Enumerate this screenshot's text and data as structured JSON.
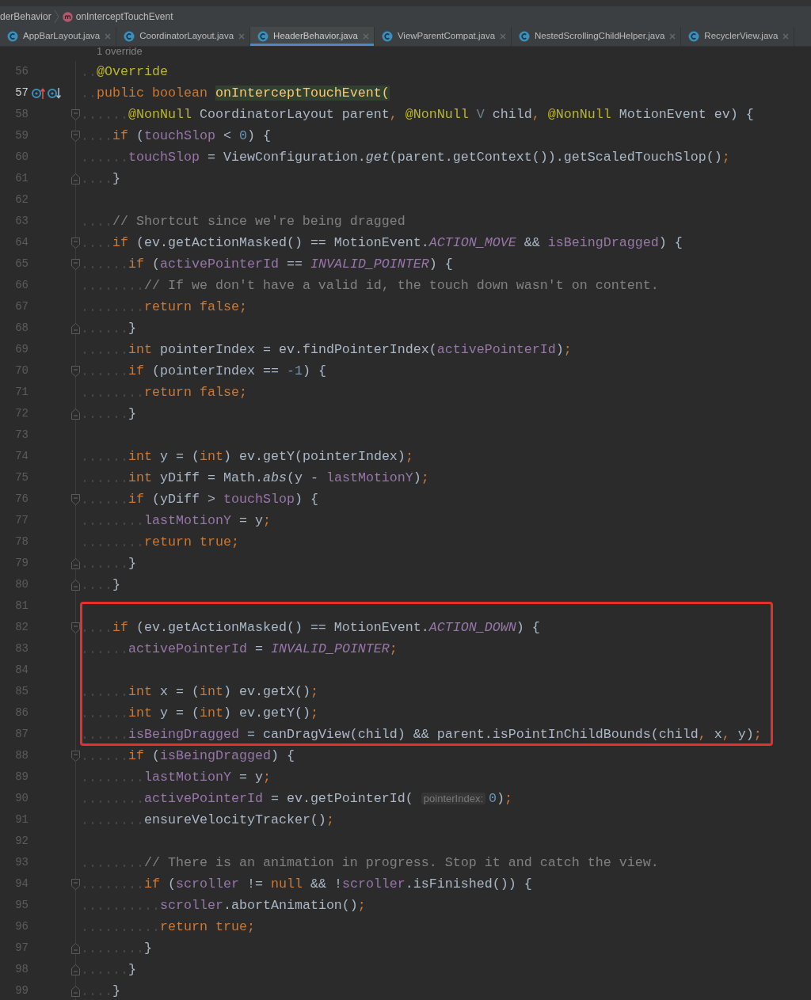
{
  "breadcrumb": [
    {
      "label": "derBehavior",
      "kind": "class"
    },
    {
      "label": "onInterceptTouchEvent",
      "kind": "method"
    }
  ],
  "tabs": [
    {
      "label": "AppBarLayout.java",
      "selected": false
    },
    {
      "label": "CoordinatorLayout.java",
      "selected": false
    },
    {
      "label": "HeaderBehavior.java",
      "selected": true
    },
    {
      "label": "ViewParentCompat.java",
      "selected": false
    },
    {
      "label": "NestedScrollingChildHelper.java",
      "selected": false
    },
    {
      "label": "RecyclerView.java",
      "selected": false
    }
  ],
  "code_vision": "1 override",
  "blocks": [
    {
      "boxed": false,
      "lines": [
        {
          "number": "56",
          "current": false,
          "tokens": [
            {
              "kind": "ann",
              "text": "  @Override"
            }
          ]
        },
        {
          "number": "57",
          "current": true,
          "gutter_icons": [
            {
              "kind": "overrides"
            },
            {
              "kind": "overridden"
            }
          ],
          "tokens": [
            {
              "kind": "kw",
              "text": "  public boolean "
            },
            {
              "kind": "decl",
              "text": "onInterceptTouchEvent("
            }
          ]
        },
        {
          "number": "58",
          "current": false,
          "fold": {
            "kind": "start"
          },
          "tokens": [
            {
              "kind": "ann",
              "text": "      @NonNull"
            },
            {
              "kind": "plain",
              "text": " CoordinatorLayout parent"
            },
            {
              "kind": "punct",
              "text": ","
            },
            {
              "kind": "ann",
              "text": " @NonNull"
            },
            {
              "kind": "tparam",
              "text": " V"
            },
            {
              "kind": "plain",
              "text": " child"
            },
            {
              "kind": "punct",
              "text": ","
            },
            {
              "kind": "ann",
              "text": " @NonNull"
            },
            {
              "kind": "plain",
              "text": " MotionEvent ev) {"
            }
          ]
        },
        {
          "number": "59",
          "current": false,
          "fold": {
            "kind": "start"
          },
          "tokens": [
            {
              "kind": "kw",
              "text": "    if"
            },
            {
              "kind": "plain",
              "text": " ("
            },
            {
              "kind": "field",
              "text": "touchSlop"
            },
            {
              "kind": "plain",
              "text": " < "
            },
            {
              "kind": "num",
              "text": "0"
            },
            {
              "kind": "plain",
              "text": ") {"
            }
          ]
        },
        {
          "number": "60",
          "current": false,
          "tokens": [
            {
              "kind": "field",
              "text": "      touchSlop"
            },
            {
              "kind": "plain",
              "text": " = ViewConfiguration."
            },
            {
              "kind": "static",
              "text": "get"
            },
            {
              "kind": "plain",
              "text": "(parent.getContext()).getScaledTouchSlop()"
            },
            {
              "kind": "punct",
              "text": ";"
            }
          ]
        },
        {
          "number": "61",
          "current": false,
          "fold": {
            "kind": "end"
          },
          "tokens": [
            {
              "kind": "plain",
              "text": "    }"
            }
          ]
        },
        {
          "number": "62",
          "current": false
        },
        {
          "number": "63",
          "current": false,
          "tokens": [
            {
              "kind": "comment",
              "text": "    // Shortcut since we're being dragged"
            }
          ]
        },
        {
          "number": "64",
          "current": false,
          "fold": {
            "kind": "start"
          },
          "tokens": [
            {
              "kind": "kw",
              "text": "    if"
            },
            {
              "kind": "plain",
              "text": " (ev.getActionMasked() == MotionEvent."
            },
            {
              "kind": "const",
              "text": "ACTION_MOVE"
            },
            {
              "kind": "plain",
              "text": " && "
            },
            {
              "kind": "field",
              "text": "isBeingDragged"
            },
            {
              "kind": "plain",
              "text": ") {"
            }
          ]
        },
        {
          "number": "65",
          "current": false,
          "fold": {
            "kind": "start"
          },
          "tokens": [
            {
              "kind": "kw",
              "text": "      if"
            },
            {
              "kind": "plain",
              "text": " ("
            },
            {
              "kind": "field",
              "text": "activePointerId"
            },
            {
              "kind": "plain",
              "text": " == "
            },
            {
              "kind": "const",
              "text": "INVALID_POINTER"
            },
            {
              "kind": "plain",
              "text": ") {"
            }
          ]
        },
        {
          "number": "66",
          "current": false,
          "tokens": [
            {
              "kind": "comment",
              "text": "        // If we don't have a valid id, the touch down wasn't on content."
            }
          ]
        },
        {
          "number": "67",
          "current": false,
          "tokens": [
            {
              "kind": "kw",
              "text": "        return false;"
            }
          ]
        },
        {
          "number": "68",
          "current": false,
          "fold": {
            "kind": "end"
          },
          "tokens": [
            {
              "kind": "plain",
              "text": "      }"
            }
          ]
        },
        {
          "number": "69",
          "current": false,
          "tokens": [
            {
              "kind": "kw",
              "text": "      int"
            },
            {
              "kind": "plain",
              "text": " pointerIndex = ev.findPointerIndex("
            },
            {
              "kind": "field",
              "text": "activePointerId"
            },
            {
              "kind": "plain",
              "text": ")"
            },
            {
              "kind": "punct",
              "text": ";"
            }
          ]
        },
        {
          "number": "70",
          "current": false,
          "fold": {
            "kind": "start"
          },
          "tokens": [
            {
              "kind": "kw",
              "text": "      if"
            },
            {
              "kind": "plain",
              "text": " (pointerIndex == "
            },
            {
              "kind": "num",
              "text": "-1"
            },
            {
              "kind": "plain",
              "text": ") {"
            }
          ]
        },
        {
          "number": "71",
          "current": false,
          "tokens": [
            {
              "kind": "kw",
              "text": "        return false;"
            }
          ]
        },
        {
          "number": "72",
          "current": false,
          "fold": {
            "kind": "end"
          },
          "tokens": [
            {
              "kind": "plain",
              "text": "      }"
            }
          ]
        },
        {
          "number": "73",
          "current": false
        },
        {
          "number": "74",
          "current": false,
          "tokens": [
            {
              "kind": "kw",
              "text": "      int"
            },
            {
              "kind": "plain",
              "text": " y = ("
            },
            {
              "kind": "kw",
              "text": "int"
            },
            {
              "kind": "plain",
              "text": ") ev.getY(pointerIndex)"
            },
            {
              "kind": "punct",
              "text": ";"
            }
          ]
        },
        {
          "number": "75",
          "current": false,
          "tokens": [
            {
              "kind": "kw",
              "text": "      int"
            },
            {
              "kind": "plain",
              "text": " yDiff = Math."
            },
            {
              "kind": "static",
              "text": "abs"
            },
            {
              "kind": "plain",
              "text": "(y - "
            },
            {
              "kind": "field",
              "text": "lastMotionY"
            },
            {
              "kind": "plain",
              "text": ")"
            },
            {
              "kind": "punct",
              "text": ";"
            }
          ]
        },
        {
          "number": "76",
          "current": false,
          "fold": {
            "kind": "start"
          },
          "tokens": [
            {
              "kind": "kw",
              "text": "      if"
            },
            {
              "kind": "plain",
              "text": " (yDiff > "
            },
            {
              "kind": "field",
              "text": "touchSlop"
            },
            {
              "kind": "plain",
              "text": ") {"
            }
          ]
        },
        {
          "number": "77",
          "current": false,
          "tokens": [
            {
              "kind": "field",
              "text": "        lastMotionY"
            },
            {
              "kind": "plain",
              "text": " = y"
            },
            {
              "kind": "punct",
              "text": ";"
            }
          ]
        },
        {
          "number": "78",
          "current": false,
          "tokens": [
            {
              "kind": "kw",
              "text": "        return true;"
            }
          ]
        },
        {
          "number": "79",
          "current": false,
          "fold": {
            "kind": "end"
          },
          "tokens": [
            {
              "kind": "plain",
              "text": "      }"
            }
          ]
        },
        {
          "number": "80",
          "current": false,
          "fold": {
            "kind": "end"
          },
          "tokens": [
            {
              "kind": "plain",
              "text": "    }"
            }
          ]
        },
        {
          "number": "81",
          "current": false
        }
      ]
    },
    {
      "boxed": true,
      "lines": [
        {
          "number": "82",
          "current": false,
          "fold": {
            "kind": "start"
          },
          "tokens": [
            {
              "kind": "kw",
              "text": "    if"
            },
            {
              "kind": "plain",
              "text": " (ev.getActionMasked() == MotionEvent."
            },
            {
              "kind": "const",
              "text": "ACTION_DOWN"
            },
            {
              "kind": "plain",
              "text": ") {"
            }
          ]
        },
        {
          "number": "83",
          "current": false,
          "tokens": [
            {
              "kind": "field",
              "text": "      activePointerId"
            },
            {
              "kind": "plain",
              "text": " = "
            },
            {
              "kind": "const",
              "text": "INVALID_POINTER"
            },
            {
              "kind": "punct",
              "text": ";"
            }
          ]
        },
        {
          "number": "84",
          "current": false
        },
        {
          "number": "85",
          "current": false,
          "tokens": [
            {
              "kind": "kw",
              "text": "      int"
            },
            {
              "kind": "plain",
              "text": " x = ("
            },
            {
              "kind": "kw",
              "text": "int"
            },
            {
              "kind": "plain",
              "text": ") ev.getX()"
            },
            {
              "kind": "punct",
              "text": ";"
            }
          ]
        },
        {
          "number": "86",
          "current": false,
          "tokens": [
            {
              "kind": "kw",
              "text": "      int"
            },
            {
              "kind": "plain",
              "text": " y = ("
            },
            {
              "kind": "kw",
              "text": "int"
            },
            {
              "kind": "plain",
              "text": ") ev.getY()"
            },
            {
              "kind": "punct",
              "text": ";"
            }
          ]
        },
        {
          "number": "87",
          "current": false,
          "tokens": [
            {
              "kind": "field",
              "text": "      isBeingDragged"
            },
            {
              "kind": "plain",
              "text": " = canDragView(child) && parent.isPointInChildBounds(child"
            },
            {
              "kind": "punct",
              "text": ","
            },
            {
              "kind": "plain",
              "text": " x"
            },
            {
              "kind": "punct",
              "text": ","
            },
            {
              "kind": "plain",
              "text": " y)"
            },
            {
              "kind": "punct",
              "text": ";"
            }
          ]
        }
      ]
    },
    {
      "boxed": false,
      "lines": [
        {
          "number": "88",
          "current": false,
          "fold": {
            "kind": "start"
          },
          "tokens": [
            {
              "kind": "kw",
              "text": "      if"
            },
            {
              "kind": "plain",
              "text": " ("
            },
            {
              "kind": "field",
              "text": "isBeingDragged"
            },
            {
              "kind": "plain",
              "text": ") {"
            }
          ]
        },
        {
          "number": "89",
          "current": false,
          "tokens": [
            {
              "kind": "field",
              "text": "        lastMotionY"
            },
            {
              "kind": "plain",
              "text": " = y"
            },
            {
              "kind": "punct",
              "text": ";"
            }
          ]
        },
        {
          "number": "90",
          "current": false,
          "tokens": [
            {
              "kind": "field",
              "text": "        activePointerId"
            },
            {
              "kind": "plain",
              "text": " = ev.getPointerId( "
            },
            {
              "kind": "hint",
              "text": "pointerIndex:"
            },
            {
              "kind": "num",
              "text": "0"
            },
            {
              "kind": "plain",
              "text": ")"
            },
            {
              "kind": "punct",
              "text": ";"
            }
          ]
        },
        {
          "number": "91",
          "current": false,
          "tokens": [
            {
              "kind": "plain",
              "text": "        ensureVelocityTracker()"
            },
            {
              "kind": "punct",
              "text": ";"
            }
          ]
        },
        {
          "number": "92",
          "current": false
        },
        {
          "number": "93",
          "current": false,
          "tokens": [
            {
              "kind": "comment",
              "text": "        // There is an animation in progress. Stop it and catch the view."
            }
          ]
        },
        {
          "number": "94",
          "current": false,
          "fold": {
            "kind": "start"
          },
          "tokens": [
            {
              "kind": "kw",
              "text": "        if"
            },
            {
              "kind": "plain",
              "text": " ("
            },
            {
              "kind": "field",
              "text": "scroller"
            },
            {
              "kind": "plain",
              "text": " != "
            },
            {
              "kind": "kw",
              "text": "null"
            },
            {
              "kind": "plain",
              "text": " && !"
            },
            {
              "kind": "field",
              "text": "scroller"
            },
            {
              "kind": "plain",
              "text": ".isFinished()) {"
            }
          ]
        },
        {
          "number": "95",
          "current": false,
          "tokens": [
            {
              "kind": "field",
              "text": "          scroller"
            },
            {
              "kind": "plain",
              "text": ".abortAnimation()"
            },
            {
              "kind": "punct",
              "text": ";"
            }
          ]
        },
        {
          "number": "96",
          "current": false,
          "tokens": [
            {
              "kind": "kw",
              "text": "          return true;"
            }
          ]
        },
        {
          "number": "97",
          "current": false,
          "fold": {
            "kind": "end"
          },
          "tokens": [
            {
              "kind": "plain",
              "text": "        }"
            }
          ]
        },
        {
          "number": "98",
          "current": false,
          "fold": {
            "kind": "end"
          },
          "tokens": [
            {
              "kind": "plain",
              "text": "      }"
            }
          ]
        },
        {
          "number": "99",
          "current": false,
          "fold": {
            "kind": "end"
          },
          "tokens": [
            {
              "kind": "plain",
              "text": "    }"
            }
          ]
        }
      ]
    }
  ]
}
